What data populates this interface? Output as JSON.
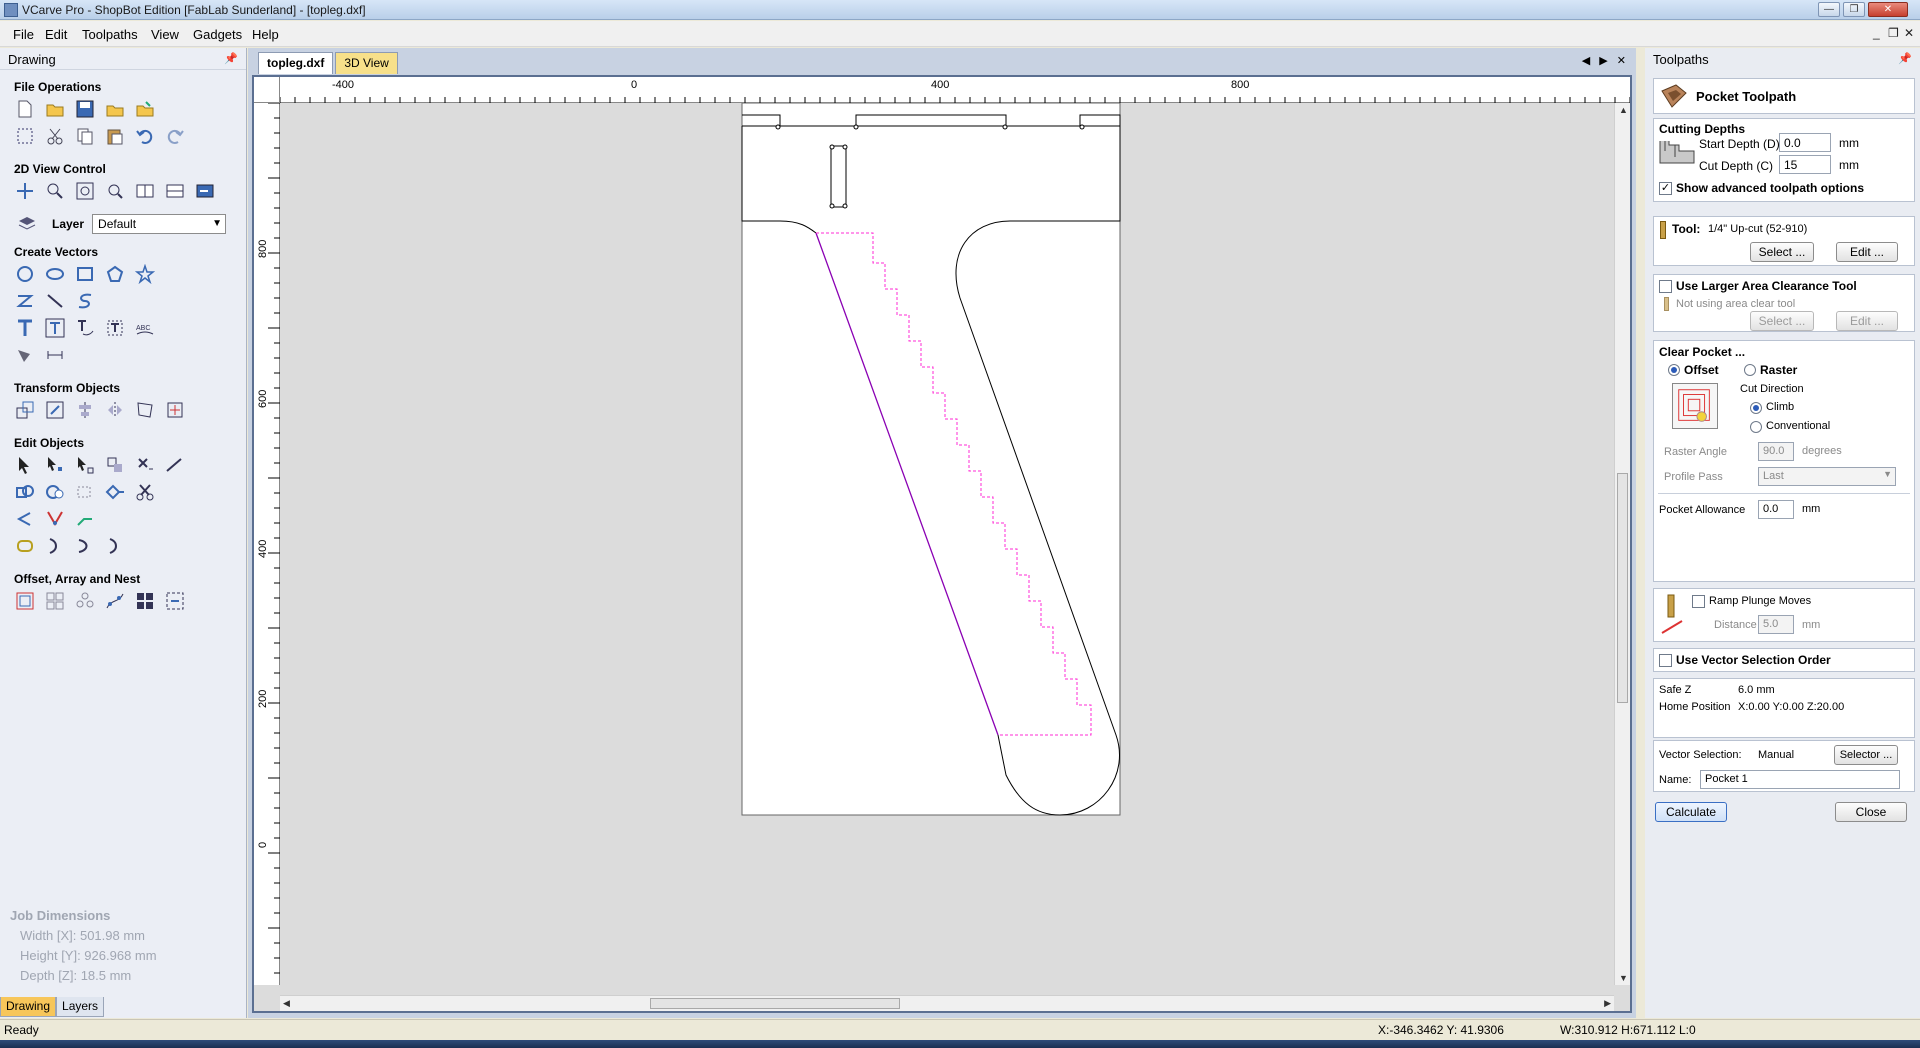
{
  "window": {
    "title": "VCarve Pro - ShopBot Edition [FabLab Sunderland] - [topleg.dxf]"
  },
  "menu": [
    "File",
    "Edit",
    "Toolpaths",
    "View",
    "Gadgets",
    "Help"
  ],
  "left_panel": {
    "title": "Drawing",
    "sections": {
      "file_ops": "File Operations",
      "view_control": "2D View Control",
      "create_vectors": "Create Vectors",
      "transform": "Transform Objects",
      "edit_objects": "Edit Objects",
      "offset": "Offset, Array and Nest"
    },
    "layer_label": "Layer",
    "layer_value": "Default",
    "job_dimensions": {
      "title": "Job Dimensions",
      "width": "Width  [X]: 501.98 mm",
      "height": "Height [Y]: 926.968 mm",
      "depth": "Depth  [Z]: 18.5 mm"
    },
    "tabs": [
      "Drawing",
      "Layers"
    ]
  },
  "document": {
    "tabs": [
      "topleg.dxf",
      "3D View"
    ],
    "ruler_x_labels": [
      "-400",
      "0",
      "400",
      "800"
    ],
    "ruler_y_labels": [
      "800",
      "600",
      "400",
      "200",
      "0"
    ]
  },
  "right_panel": {
    "title": "Toolpaths",
    "pocket_title": "Pocket Toolpath",
    "cutting_depths": "Cutting Depths",
    "start_depth_label": "Start Depth (D)",
    "start_depth_value": "0.0",
    "cut_depth_label": "Cut Depth (C)",
    "cut_depth_value": "15",
    "unit": "mm",
    "show_advanced": "Show advanced toolpath options",
    "tool_label": "Tool:",
    "tool_value": "1/4\" Up-cut (52-910)",
    "select_btn": "Select ...",
    "edit_btn": "Edit ...",
    "larger_area": "Use Larger Area Clearance Tool",
    "not_using": "Not using area clear tool",
    "clear_pocket": "Clear Pocket ...",
    "offset": "Offset",
    "raster": "Raster",
    "cut_direction": "Cut Direction",
    "climb": "Climb",
    "conventional": "Conventional",
    "raster_angle_label": "Raster Angle",
    "raster_angle_value": "90.0",
    "degrees": "degrees",
    "profile_pass_label": "Profile Pass",
    "profile_pass_value": "Last",
    "pocket_allowance_label": "Pocket Allowance",
    "pocket_allowance_value": "0.0",
    "ramp": "Ramp Plunge Moves",
    "distance_label": "Distance",
    "distance_value": "5.0",
    "vector_order": "Use Vector Selection Order",
    "safe_z_label": "Safe Z",
    "safe_z_value": "6.0 mm",
    "home_label": "Home Position",
    "home_value": "X:0.00 Y:0.00 Z:20.00",
    "vector_selection_label": "Vector Selection:",
    "vector_selection_value": "Manual",
    "selector_btn": "Selector ...",
    "name_label": "Name:",
    "name_value": "Pocket 1",
    "calculate_btn": "Calculate",
    "close_btn": "Close"
  },
  "status": {
    "ready": "Ready",
    "coords": "X:-346.3462 Y: 41.9306",
    "size": "W:310.912  H:671.112  L:0"
  }
}
